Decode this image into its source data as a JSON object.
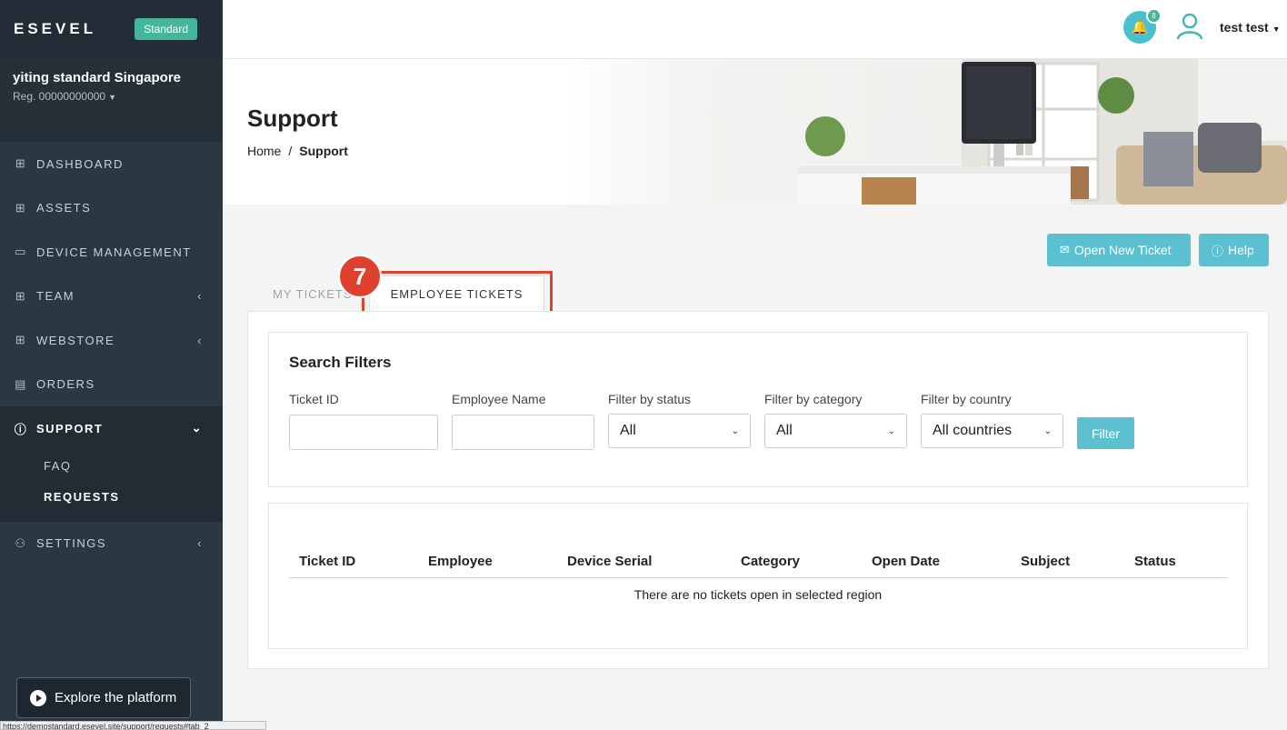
{
  "sidebar": {
    "brand": "ESEVEL",
    "plan": "Standard",
    "org_name": "yiting standard Singapore",
    "org_reg": "Reg. 00000000000",
    "nav": [
      {
        "icon": "grid-icon",
        "label": "DASHBOARD"
      },
      {
        "icon": "grid-icon",
        "label": "ASSETS"
      },
      {
        "icon": "laptop-icon",
        "label": "DEVICE MANAGEMENT"
      },
      {
        "icon": "grid-icon",
        "label": "TEAM"
      },
      {
        "icon": "grid-icon",
        "label": "WEBSTORE"
      },
      {
        "icon": "document-icon",
        "label": "ORDERS"
      },
      {
        "icon": "info-icon",
        "label": "SUPPORT"
      },
      {
        "icon": "users-icon",
        "label": "SETTINGS"
      }
    ],
    "support_sub": [
      {
        "label": "FAQ"
      },
      {
        "label": "REQUESTS"
      }
    ],
    "explore": "Explore the platform",
    "status_url": "https://demostandard.esevel.site/support/requests#tab_2"
  },
  "topbar": {
    "notification_count": "8",
    "user_name": "test test"
  },
  "banner": {
    "title": "Support",
    "breadcrumb_home": "Home",
    "breadcrumb_current": "Support"
  },
  "actions": {
    "open_ticket": "Open New Ticket",
    "help": "Help"
  },
  "tabs": {
    "my": "MY TICKETS",
    "employee": "EMPLOYEE TICKETS",
    "step_marker": "7"
  },
  "filters": {
    "title": "Search Filters",
    "ticket_id_label": "Ticket ID",
    "employee_name_label": "Employee Name",
    "status_label": "Filter by status",
    "status_value": "All",
    "category_label": "Filter by category",
    "category_value": "All",
    "country_label": "Filter by country",
    "country_value": "All countries",
    "filter_button": "Filter"
  },
  "table": {
    "columns": [
      "Ticket ID",
      "Employee",
      "Device Serial",
      "Category",
      "Open Date",
      "Subject",
      "Status"
    ],
    "empty_message": "There are no tickets open in selected region"
  },
  "colors": {
    "sidebar": "#2b3743",
    "accent": "#5bc0d0",
    "badge_green": "#45b59b",
    "highlight_red": "#e0412f"
  }
}
